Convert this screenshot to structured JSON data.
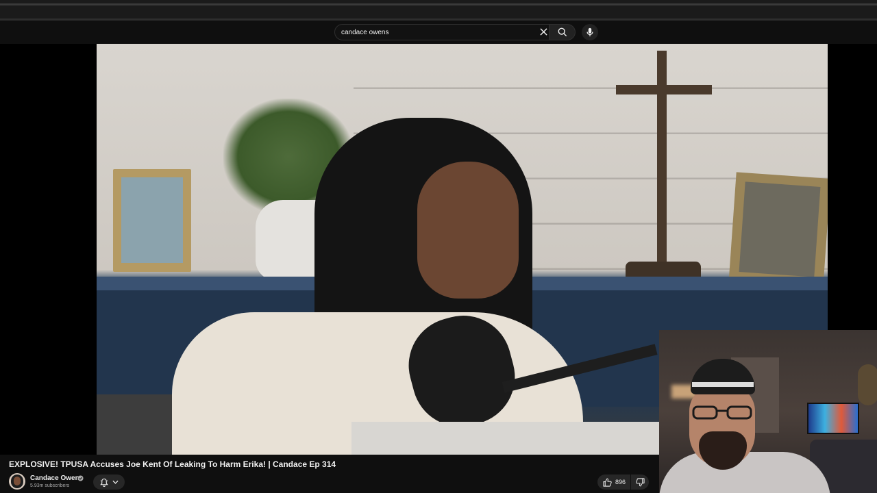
{
  "search": {
    "value": "candace owens",
    "placeholder": "Search"
  },
  "icons": {
    "clear": "close-icon",
    "search": "search-icon",
    "mic": "mic-icon",
    "bell": "bell-icon",
    "chevron": "chevron-down-icon",
    "like": "thumbs-up-icon",
    "dislike": "thumbs-down-icon",
    "verified": "verified-check-icon"
  },
  "video": {
    "title": "EXPLOSIVE! TPUSA Accuses Joe Kent Of Leaking To Harm Erika! | Candace Ep 314"
  },
  "channel": {
    "name": "Candace Owens",
    "subscribers": "5.93m subscribers"
  },
  "actions": {
    "like_count": "896"
  },
  "colors": {
    "background": "#0f0f0f",
    "button": "#272727",
    "text_primary": "#f1f1f1",
    "text_secondary": "#aaaaaa"
  }
}
